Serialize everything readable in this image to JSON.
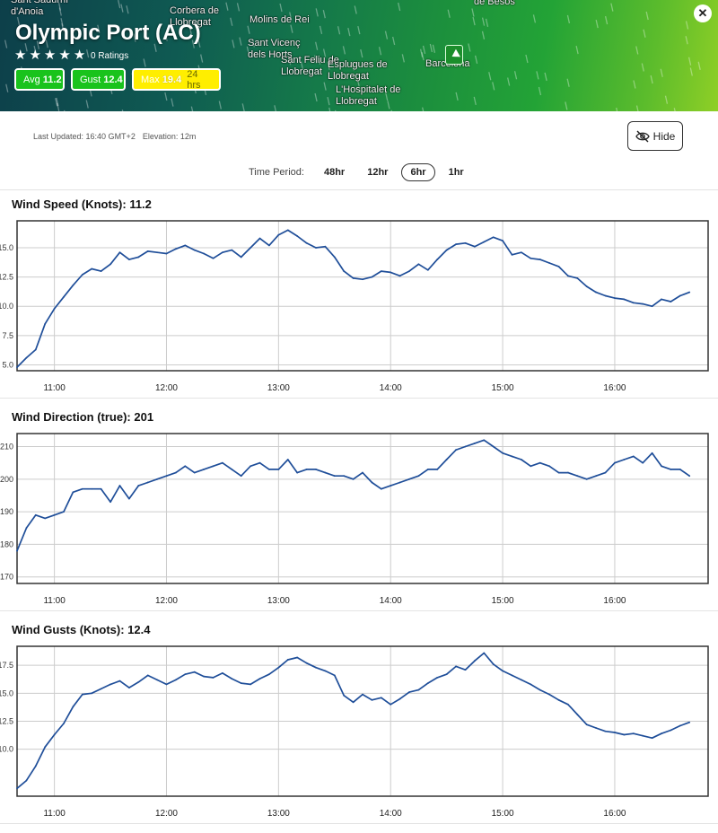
{
  "map": {
    "labels": [
      {
        "text": "Sant Sadurní\nd'Anoia",
        "name": "map-label-sant-sadurni"
      },
      {
        "text": "Corbera de\nLlobregat",
        "name": "map-label-corbera"
      },
      {
        "text": "Molins de Rei",
        "name": "map-label-molins"
      },
      {
        "text": "Sant Vicenç\ndels Horts",
        "name": "map-label-sant-vicenc"
      },
      {
        "text": "Sant Feliu de\nLlobregat",
        "name": "map-label-sant-feliu"
      },
      {
        "text": "Esplugues de\nLlobregat",
        "name": "map-label-esplugues"
      },
      {
        "text": "L'Hospitalet de\nLlobregat",
        "name": "map-label-hospitalet"
      },
      {
        "text": "Barcelona",
        "name": "map-label-barcelona"
      },
      {
        "text": "de Besòs",
        "name": "map-label-besos"
      }
    ]
  },
  "station": {
    "title": "Olympic Port (AC)",
    "stars": [
      "★",
      "★",
      "★",
      "★",
      "★"
    ],
    "ratings": "0 Ratings",
    "close_icon": "✕",
    "badges": {
      "avg_label": "Avg",
      "avg_value": "11.2",
      "gust_label": "Gust",
      "gust_value": "12.4",
      "max_label": "Max",
      "max_value": "19.4",
      "max_period": "24 hrs"
    }
  },
  "info": {
    "last_updated": "Last Updated: 16:40 GMT+2",
    "elevation": "Elevation: 12m",
    "hide_label": "Hide"
  },
  "time_period": {
    "label": "Time Period:",
    "options": [
      "48hr",
      "12hr",
      "6hr",
      "1hr"
    ],
    "selected": "6hr"
  },
  "colors": {
    "line": "#1f4e99",
    "grid": "#cccccc",
    "frame": "#333333",
    "avg_badge": "#19c31c",
    "max_badge": "#ffee00"
  },
  "chart_data": [
    {
      "type": "line",
      "title": "Wind Speed (Knots): 11.2",
      "ylim": [
        4.5,
        17.3
      ],
      "yticks": [
        "5.0",
        "7.5",
        "10.0",
        "12.5",
        "15.0"
      ],
      "xticks": [
        "11:00",
        "12:00",
        "13:00",
        "14:00",
        "15:00",
        "16:00"
      ],
      "xlim": [
        "10:40",
        "16:50"
      ],
      "series": [
        {
          "points": [
            [
              "10:40",
              4.8
            ],
            [
              "10:45",
              5.6
            ],
            [
              "10:50",
              6.3
            ],
            [
              "10:55",
              8.5
            ],
            [
              "11:00",
              9.8
            ],
            [
              "11:05",
              10.8
            ],
            [
              "11:10",
              11.8
            ],
            [
              "11:15",
              12.7
            ],
            [
              "11:20",
              13.2
            ],
            [
              "11:25",
              13.0
            ],
            [
              "11:30",
              13.6
            ],
            [
              "11:35",
              14.6
            ],
            [
              "11:40",
              14.0
            ],
            [
              "11:45",
              14.2
            ],
            [
              "11:50",
              14.7
            ],
            [
              "11:55",
              14.6
            ],
            [
              "12:00",
              14.5
            ],
            [
              "12:05",
              14.9
            ],
            [
              "12:10",
              15.2
            ],
            [
              "12:15",
              14.8
            ],
            [
              "12:20",
              14.5
            ],
            [
              "12:25",
              14.1
            ],
            [
              "12:30",
              14.6
            ],
            [
              "12:35",
              14.8
            ],
            [
              "12:40",
              14.2
            ],
            [
              "12:45",
              15.0
            ],
            [
              "12:50",
              15.8
            ],
            [
              "12:55",
              15.2
            ],
            [
              "13:00",
              16.1
            ],
            [
              "13:05",
              16.5
            ],
            [
              "13:10",
              16.0
            ],
            [
              "13:15",
              15.4
            ],
            [
              "13:20",
              15.0
            ],
            [
              "13:25",
              15.1
            ],
            [
              "13:30",
              14.2
            ],
            [
              "13:35",
              13.0
            ],
            [
              "13:40",
              12.4
            ],
            [
              "13:45",
              12.3
            ],
            [
              "13:50",
              12.5
            ],
            [
              "13:55",
              13.0
            ],
            [
              "14:00",
              12.9
            ],
            [
              "14:05",
              12.6
            ],
            [
              "14:10",
              13.0
            ],
            [
              "14:15",
              13.6
            ],
            [
              "14:20",
              13.1
            ],
            [
              "14:25",
              14.0
            ],
            [
              "14:30",
              14.8
            ],
            [
              "14:35",
              15.3
            ],
            [
              "14:40",
              15.4
            ],
            [
              "14:45",
              15.1
            ],
            [
              "14:50",
              15.5
            ],
            [
              "14:55",
              15.9
            ],
            [
              "15:00",
              15.6
            ],
            [
              "15:05",
              14.4
            ],
            [
              "15:10",
              14.6
            ],
            [
              "15:15",
              14.1
            ],
            [
              "15:20",
              14.0
            ],
            [
              "15:25",
              13.7
            ],
            [
              "15:30",
              13.4
            ],
            [
              "15:35",
              12.6
            ],
            [
              "15:40",
              12.4
            ],
            [
              "15:45",
              11.7
            ],
            [
              "15:50",
              11.2
            ],
            [
              "15:55",
              10.9
            ],
            [
              "16:00",
              10.7
            ],
            [
              "16:05",
              10.6
            ],
            [
              "16:10",
              10.3
            ],
            [
              "16:15",
              10.2
            ],
            [
              "16:20",
              10.0
            ],
            [
              "16:25",
              10.6
            ],
            [
              "16:30",
              10.4
            ],
            [
              "16:35",
              10.9
            ],
            [
              "16:40",
              11.2
            ]
          ]
        }
      ]
    },
    {
      "type": "line",
      "title": "Wind Direction (true): 201",
      "ylim": [
        168,
        214
      ],
      "yticks": [
        "170",
        "180",
        "190",
        "200",
        "210"
      ],
      "xticks": [
        "11:00",
        "12:00",
        "13:00",
        "14:00",
        "15:00",
        "16:00"
      ],
      "xlim": [
        "10:40",
        "16:50"
      ],
      "series": [
        {
          "points": [
            [
              "10:40",
              178
            ],
            [
              "10:45",
              185
            ],
            [
              "10:50",
              189
            ],
            [
              "10:55",
              188
            ],
            [
              "11:00",
              189
            ],
            [
              "11:05",
              190
            ],
            [
              "11:10",
              196
            ],
            [
              "11:15",
              197
            ],
            [
              "11:20",
              197
            ],
            [
              "11:25",
              197
            ],
            [
              "11:30",
              193
            ],
            [
              "11:35",
              198
            ],
            [
              "11:40",
              194
            ],
            [
              "11:45",
              198
            ],
            [
              "11:50",
              199
            ],
            [
              "11:55",
              200
            ],
            [
              "12:00",
              201
            ],
            [
              "12:05",
              202
            ],
            [
              "12:10",
              204
            ],
            [
              "12:15",
              202
            ],
            [
              "12:20",
              203
            ],
            [
              "12:25",
              204
            ],
            [
              "12:30",
              205
            ],
            [
              "12:35",
              203
            ],
            [
              "12:40",
              201
            ],
            [
              "12:45",
              204
            ],
            [
              "12:50",
              205
            ],
            [
              "12:55",
              203
            ],
            [
              "13:00",
              203
            ],
            [
              "13:05",
              206
            ],
            [
              "13:10",
              202
            ],
            [
              "13:15",
              203
            ],
            [
              "13:20",
              203
            ],
            [
              "13:25",
              202
            ],
            [
              "13:30",
              201
            ],
            [
              "13:35",
              201
            ],
            [
              "13:40",
              200
            ],
            [
              "13:45",
              202
            ],
            [
              "13:50",
              199
            ],
            [
              "13:55",
              197
            ],
            [
              "14:00",
              198
            ],
            [
              "14:05",
              199
            ],
            [
              "14:10",
              200
            ],
            [
              "14:15",
              201
            ],
            [
              "14:20",
              203
            ],
            [
              "14:25",
              203
            ],
            [
              "14:30",
              206
            ],
            [
              "14:35",
              209
            ],
            [
              "14:40",
              210
            ],
            [
              "14:45",
              211
            ],
            [
              "14:50",
              212
            ],
            [
              "14:55",
              210
            ],
            [
              "15:00",
              208
            ],
            [
              "15:05",
              207
            ],
            [
              "15:10",
              206
            ],
            [
              "15:15",
              204
            ],
            [
              "15:20",
              205
            ],
            [
              "15:25",
              204
            ],
            [
              "15:30",
              202
            ],
            [
              "15:35",
              202
            ],
            [
              "15:40",
              201
            ],
            [
              "15:45",
              200
            ],
            [
              "15:50",
              201
            ],
            [
              "15:55",
              202
            ],
            [
              "16:00",
              205
            ],
            [
              "16:05",
              206
            ],
            [
              "16:10",
              207
            ],
            [
              "16:15",
              205
            ],
            [
              "16:20",
              208
            ],
            [
              "16:25",
              204
            ],
            [
              "16:30",
              203
            ],
            [
              "16:35",
              203
            ],
            [
              "16:40",
              201
            ]
          ]
        }
      ]
    },
    {
      "type": "line",
      "title": "Wind Gusts (Knots): 12.4",
      "ylim": [
        5.8,
        19.2
      ],
      "yticks": [
        "10.0",
        "12.5",
        "15.0",
        "17.5"
      ],
      "xticks": [
        "11:00",
        "12:00",
        "13:00",
        "14:00",
        "15:00",
        "16:00"
      ],
      "xlim": [
        "10:40",
        "16:50"
      ],
      "series": [
        {
          "points": [
            [
              "10:40",
              6.5
            ],
            [
              "10:45",
              7.2
            ],
            [
              "10:50",
              8.5
            ],
            [
              "10:55",
              10.2
            ],
            [
              "11:00",
              11.3
            ],
            [
              "11:05",
              12.3
            ],
            [
              "11:10",
              13.8
            ],
            [
              "11:15",
              14.9
            ],
            [
              "11:20",
              15.0
            ],
            [
              "11:25",
              15.4
            ],
            [
              "11:30",
              15.8
            ],
            [
              "11:35",
              16.1
            ],
            [
              "11:40",
              15.5
            ],
            [
              "11:45",
              16.0
            ],
            [
              "11:50",
              16.6
            ],
            [
              "11:55",
              16.2
            ],
            [
              "12:00",
              15.8
            ],
            [
              "12:05",
              16.2
            ],
            [
              "12:10",
              16.7
            ],
            [
              "12:15",
              16.9
            ],
            [
              "12:20",
              16.5
            ],
            [
              "12:25",
              16.4
            ],
            [
              "12:30",
              16.8
            ],
            [
              "12:35",
              16.3
            ],
            [
              "12:40",
              15.9
            ],
            [
              "12:45",
              15.8
            ],
            [
              "12:50",
              16.3
            ],
            [
              "12:55",
              16.7
            ],
            [
              "13:00",
              17.3
            ],
            [
              "13:05",
              18.0
            ],
            [
              "13:10",
              18.2
            ],
            [
              "13:15",
              17.7
            ],
            [
              "13:20",
              17.3
            ],
            [
              "13:25",
              17.0
            ],
            [
              "13:30",
              16.6
            ],
            [
              "13:35",
              14.8
            ],
            [
              "13:40",
              14.2
            ],
            [
              "13:45",
              14.9
            ],
            [
              "13:50",
              14.4
            ],
            [
              "13:55",
              14.6
            ],
            [
              "14:00",
              14.0
            ],
            [
              "14:05",
              14.5
            ],
            [
              "14:10",
              15.1
            ],
            [
              "14:15",
              15.3
            ],
            [
              "14:20",
              15.9
            ],
            [
              "14:25",
              16.4
            ],
            [
              "14:30",
              16.7
            ],
            [
              "14:35",
              17.4
            ],
            [
              "14:40",
              17.1
            ],
            [
              "14:45",
              17.9
            ],
            [
              "14:50",
              18.6
            ],
            [
              "14:55",
              17.6
            ],
            [
              "15:00",
              17.0
            ],
            [
              "15:05",
              16.6
            ],
            [
              "15:10",
              16.2
            ],
            [
              "15:15",
              15.8
            ],
            [
              "15:20",
              15.3
            ],
            [
              "15:25",
              14.9
            ],
            [
              "15:30",
              14.4
            ],
            [
              "15:35",
              14.0
            ],
            [
              "15:40",
              13.1
            ],
            [
              "15:45",
              12.2
            ],
            [
              "15:50",
              11.9
            ],
            [
              "15:55",
              11.6
            ],
            [
              "16:00",
              11.5
            ],
            [
              "16:05",
              11.3
            ],
            [
              "16:10",
              11.4
            ],
            [
              "16:15",
              11.2
            ],
            [
              "16:20",
              11.0
            ],
            [
              "16:25",
              11.4
            ],
            [
              "16:30",
              11.7
            ],
            [
              "16:35",
              12.1
            ],
            [
              "16:40",
              12.4
            ]
          ]
        }
      ]
    }
  ]
}
